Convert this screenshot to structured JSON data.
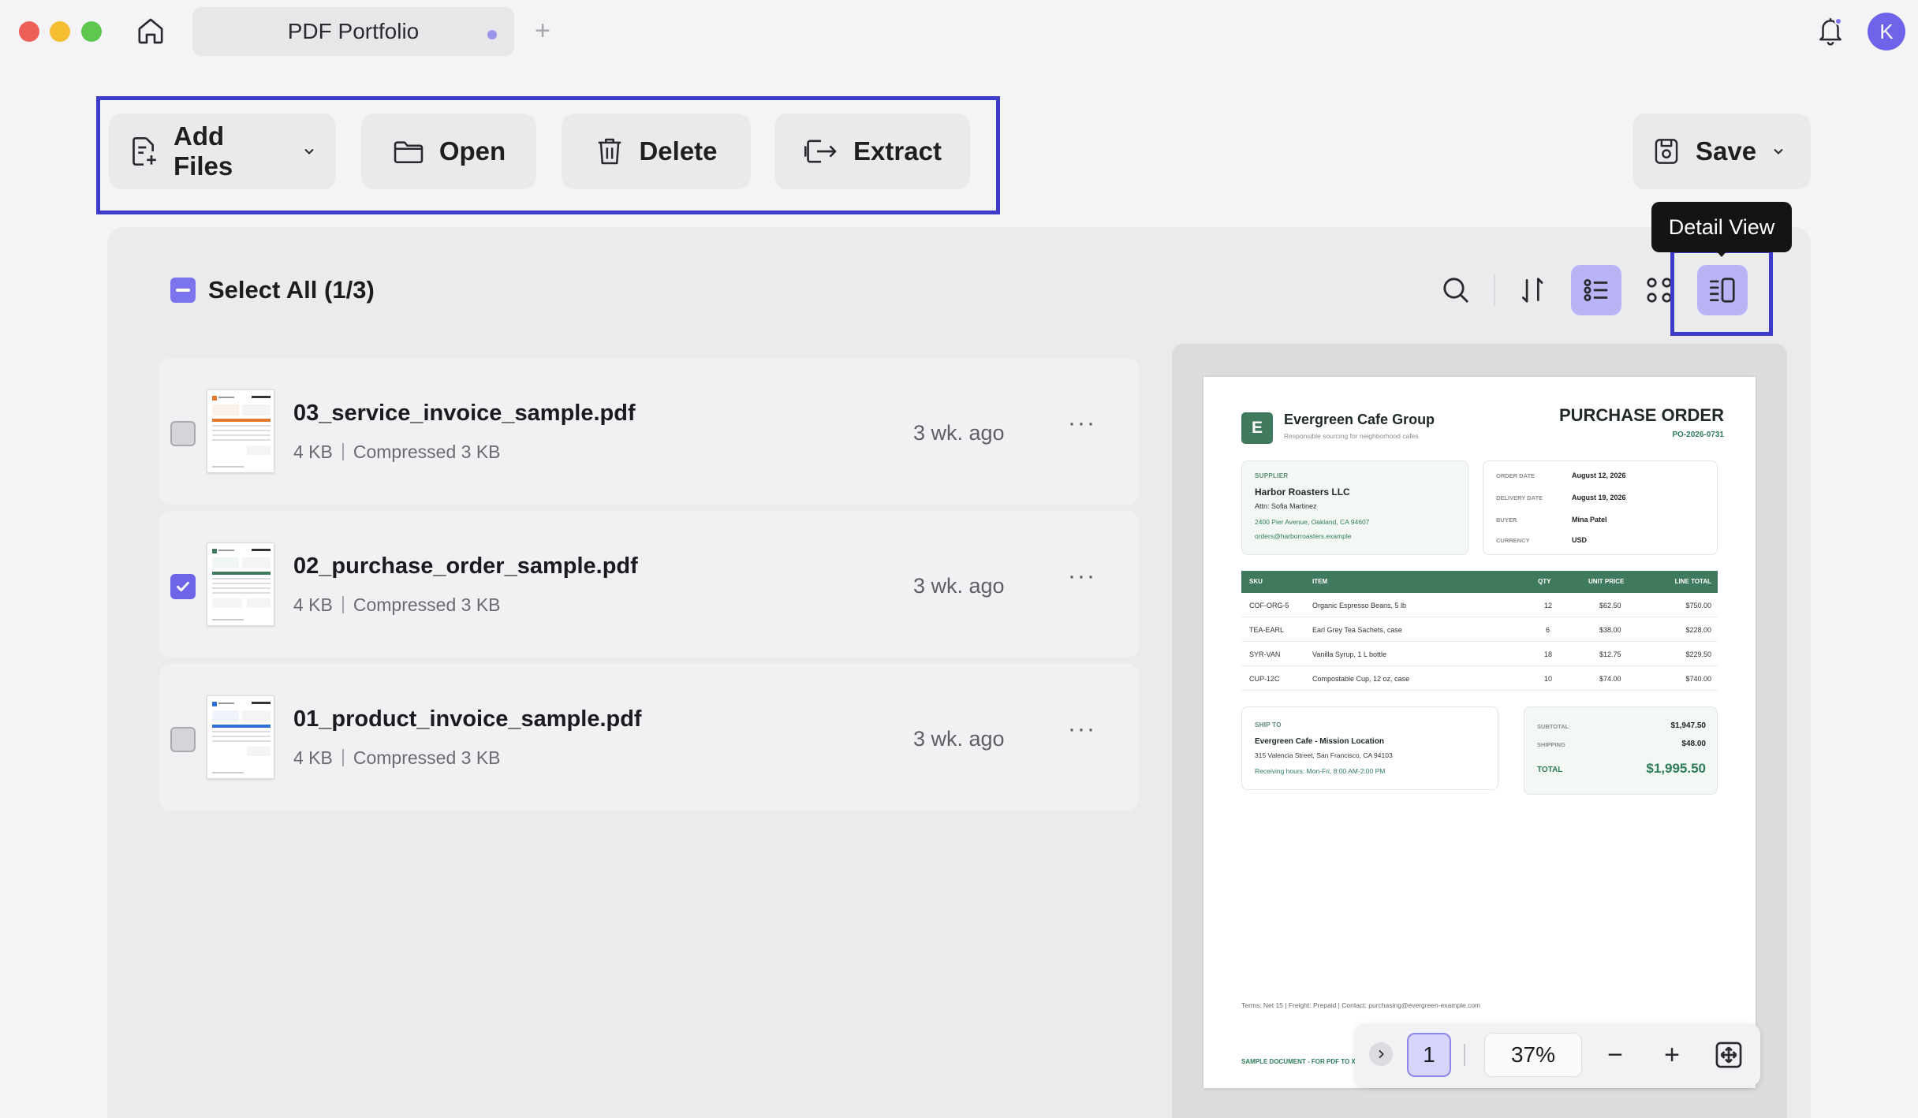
{
  "titlebar": {
    "tab_title": "PDF Portfolio",
    "new_tab_label": "+",
    "avatar_initial": "K"
  },
  "toolbar": {
    "add_files_label": "Add Files",
    "open_label": "Open",
    "delete_label": "Delete",
    "extract_label": "Extract",
    "save_label": "Save"
  },
  "list": {
    "select_all_label": "Select All (1/3)",
    "tooltip_detail_view": "Detail View",
    "files": [
      {
        "name": "03_service_invoice_sample.pdf",
        "size": "4 KB",
        "compressed": "Compressed 3 KB",
        "time": "3 wk. ago",
        "checked": false,
        "more": "···"
      },
      {
        "name": "02_purchase_order_sample.pdf",
        "size": "4 KB",
        "compressed": "Compressed 3 KB",
        "time": "3 wk. ago",
        "checked": true,
        "more": "···"
      },
      {
        "name": "01_product_invoice_sample.pdf",
        "size": "4 KB",
        "compressed": "Compressed 3 KB",
        "time": "3 wk. ago",
        "checked": false,
        "more": "···"
      }
    ]
  },
  "preview": {
    "logo_letter": "E",
    "company": "Evergreen Cafe Group",
    "tagline": "Responsible sourcing for neighborhood cafes",
    "doc_title": "PURCHASE ORDER",
    "doc_number": "PO-2026-0731",
    "supplier": {
      "label": "SUPPLIER",
      "name": "Harbor Roasters LLC",
      "attn": "Attn: Sofia Martinez",
      "address": "2400 Pier Avenue, Oakland, CA 94607",
      "email": "orders@harborroasters.example"
    },
    "meta": [
      {
        "label": "ORDER DATE",
        "value": "August 12, 2026"
      },
      {
        "label": "DELIVERY DATE",
        "value": "August 19, 2026"
      },
      {
        "label": "BUYER",
        "value": "Mina Patel"
      },
      {
        "label": "CURRENCY",
        "value": "USD"
      }
    ],
    "table_headers": {
      "sku": "SKU",
      "item": "ITEM",
      "qty": "QTY",
      "unit_price": "UNIT PRICE",
      "line_total": "LINE TOTAL"
    },
    "items": [
      {
        "sku": "COF-ORG-5",
        "item": "Organic Espresso Beans, 5 lb",
        "qty": "12",
        "unit_price": "$62.50",
        "line_total": "$750.00"
      },
      {
        "sku": "TEA-EARL",
        "item": "Earl Grey Tea Sachets, case",
        "qty": "6",
        "unit_price": "$38.00",
        "line_total": "$228.00"
      },
      {
        "sku": "SYR-VAN",
        "item": "Vanilla Syrup, 1 L bottle",
        "qty": "18",
        "unit_price": "$12.75",
        "line_total": "$229.50"
      },
      {
        "sku": "CUP-12C",
        "item": "Compostable Cup, 12 oz, case",
        "qty": "10",
        "unit_price": "$74.00",
        "line_total": "$740.00"
      }
    ],
    "ship_to": {
      "label": "SHIP TO",
      "name": "Evergreen Cafe - Mission Location",
      "address": "315 Valencia Street, San Francisco, CA 94103",
      "hours": "Receiving hours: Mon-Fri, 8:00 AM-2:00 PM"
    },
    "totals": {
      "subtotal_label": "SUBTOTAL",
      "subtotal": "$1,947.50",
      "shipping_label": "SHIPPING",
      "shipping": "$48.00",
      "total_label": "TOTAL",
      "total": "$1,995.50"
    },
    "terms": "Terms: Net 15 | Freight: Prepaid | Contact: purchasing@evergreen-example.com",
    "footer_note": "SAMPLE DOCUMENT - FOR PDF TO X"
  },
  "viewer": {
    "page_number": "1",
    "zoom": "37%",
    "minus": "−",
    "plus": "+"
  },
  "colors": {
    "accent": "#6e64ea",
    "highlight_box": "#3e3bc8",
    "doc_green": "#3f7a5e"
  }
}
